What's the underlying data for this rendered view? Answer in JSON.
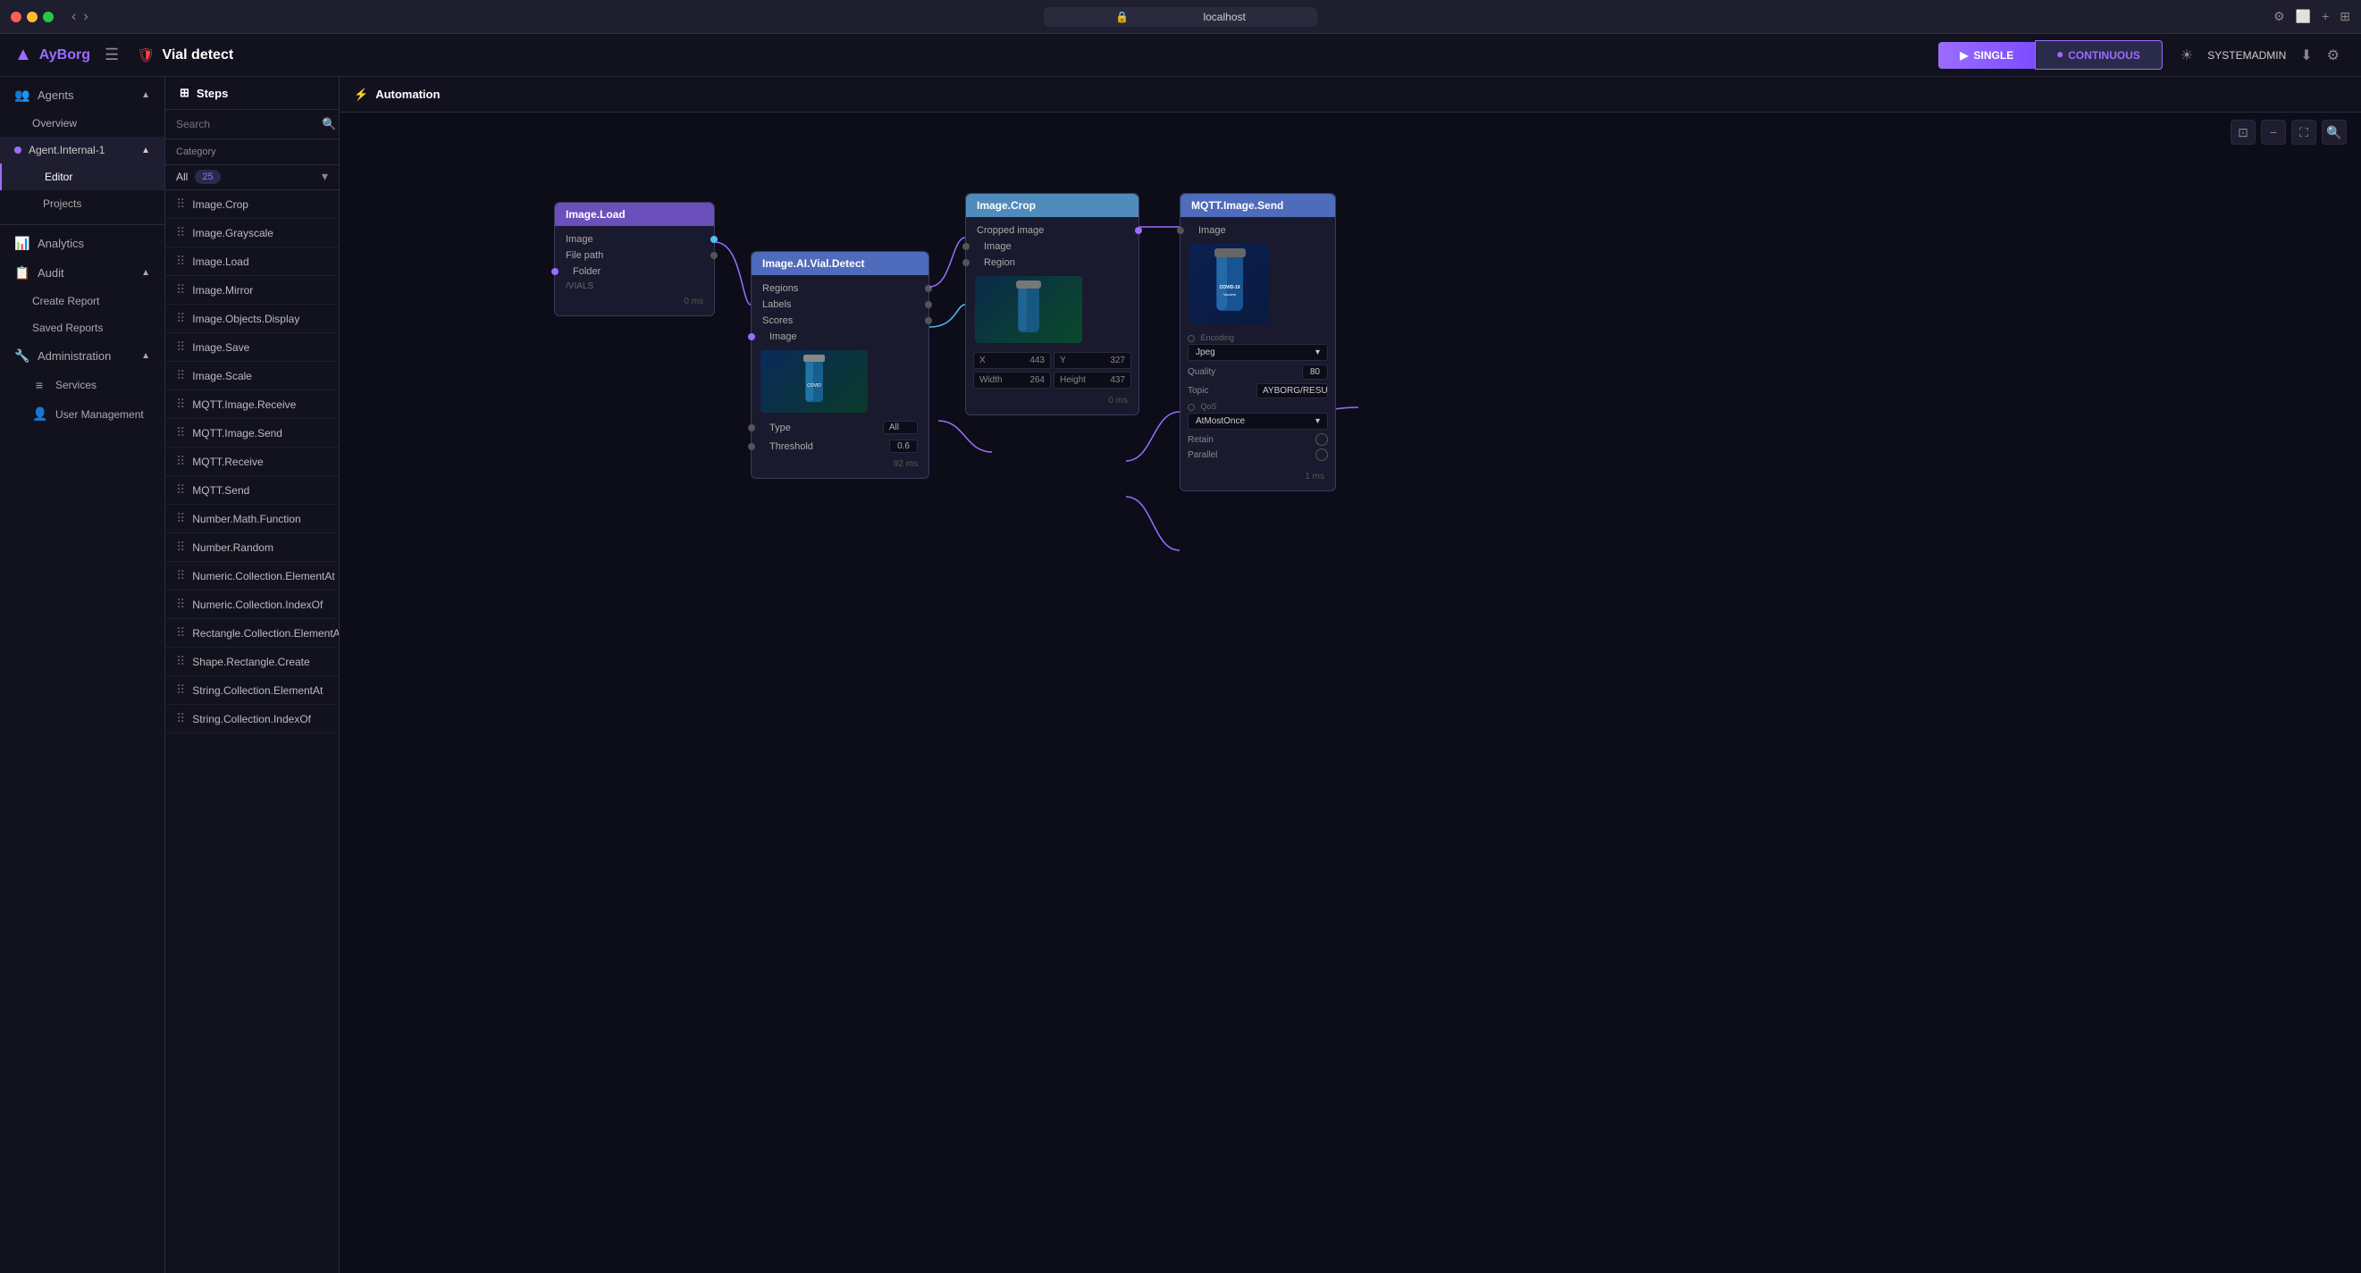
{
  "titlebar": {
    "url": "localhost",
    "lock_icon": "🔒"
  },
  "appbar": {
    "logo_text": "AyBorg",
    "hamburger_label": "☰",
    "agent_icon": "🛡",
    "agent_name": "Vial detect",
    "btn_single": "SINGLE",
    "btn_continuous": "CONTINUOUS",
    "sun_icon": "☀",
    "username": "SYSTEMADMIN",
    "download_icon": "⬇",
    "settings_icon": "⚙"
  },
  "sidebar": {
    "agents_label": "Agents",
    "agent_internal": "Agent.Internal-1",
    "editor_label": "Editor",
    "projects_label": "Projects",
    "analytics_label": "Analytics",
    "audit_label": "Audit",
    "create_report_label": "Create Report",
    "saved_reports_label": "Saved Reports",
    "administration_label": "Administration",
    "services_label": "Services",
    "user_management_label": "User Management"
  },
  "steps_panel": {
    "title": "Steps",
    "search_placeholder": "Search",
    "category_label": "Category",
    "category_value": "All",
    "category_count": "25",
    "items": [
      "Image.Crop",
      "Image.Grayscale",
      "Image.Load",
      "Image.Mirror",
      "Image.Objects.Display",
      "Image.Save",
      "Image.Scale",
      "MQTT.Image.Receive",
      "MQTT.Image.Send",
      "MQTT.Receive",
      "MQTT.Send",
      "Number.Math.Function",
      "Number.Random",
      "Numeric.Collection.ElementAt",
      "Numeric.Collection.IndexOf",
      "Rectangle.Collection.ElementAt",
      "Shape.Rectangle.Create",
      "String.Collection.ElementAt",
      "String.Collection.IndexOf"
    ]
  },
  "automation": {
    "tab_label": "Automation",
    "automation_icon": "⚡"
  },
  "nodes": {
    "image_load": {
      "title": "Image.Load",
      "port_image": "Image",
      "port_file_path": "File path",
      "port_folder": "Folder",
      "folder_value": "/VIALS",
      "time": "0 ms"
    },
    "image_ai": {
      "title": "Image.AI.Vial.Detect",
      "port_regions": "Regions",
      "port_labels": "Labels",
      "port_scores": "Scores",
      "port_image": "Image",
      "port_type": "Type",
      "type_value": "All",
      "port_threshold": "Threshold",
      "threshold_value": "0.6",
      "time": "92 ms"
    },
    "image_crop": {
      "title": "Image.Crop",
      "port_cropped_image": "Cropped image",
      "port_image": "Image",
      "port_region": "Region",
      "field_x": "X",
      "field_x_value": "443",
      "field_y": "Y",
      "field_y_value": "327",
      "field_width": "Width",
      "field_width_value": "264",
      "field_height": "Height",
      "field_height_value": "437",
      "time": "0 ms"
    },
    "mqtt_send": {
      "title": "MQTT.Image.Send",
      "port_image": "Image",
      "encoding_label": "Encoding",
      "encoding_value": "Jpeg",
      "quality_label": "Quality",
      "quality_value": "80",
      "topic_label": "Topic",
      "topic_value": "AYBORG/RESU...",
      "qos_label": "QoS",
      "qos_value": "AtMostOnce",
      "retain_label": "Retain",
      "parallel_label": "Parallel",
      "time": "1 ms"
    }
  },
  "canvas_toolbar": {
    "fit_icon": "⊞",
    "zoom_out_icon": "−",
    "fullscreen_icon": "⛶",
    "search_icon": "🔍"
  },
  "colors": {
    "purple": "#9b6dff",
    "dark_bg": "#12121f",
    "node_bg": "#1a1a2e",
    "canvas_bg": "#0d0d1a"
  }
}
